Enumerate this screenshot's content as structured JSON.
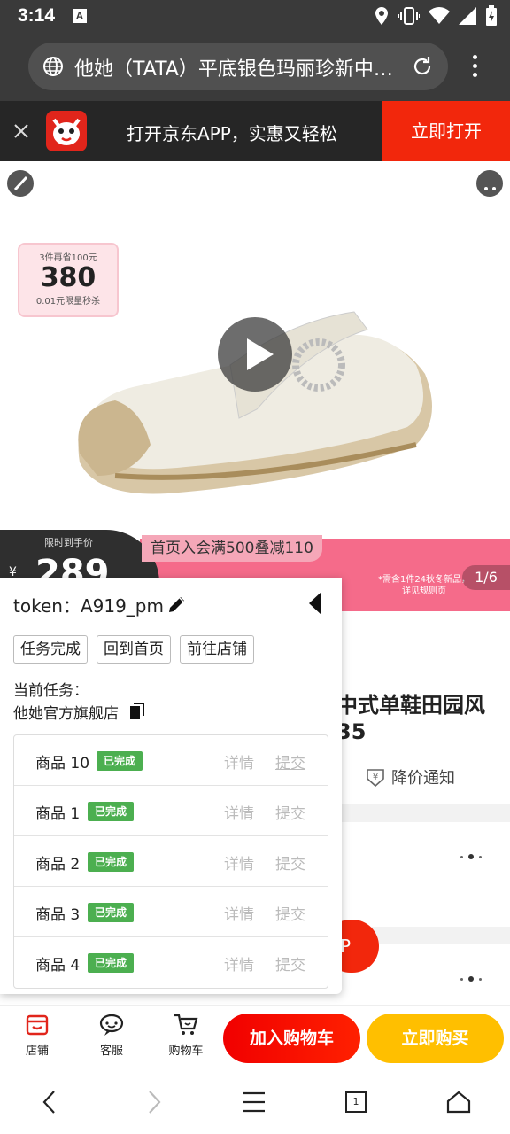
{
  "status_bar": {
    "time": "3:14",
    "notif_glyph": "A"
  },
  "browser": {
    "url_title": "他她（TATA）平底银色玛丽珍新中式单鞋田园风",
    "icons": [
      "globe-icon",
      "reload-icon",
      "overflow-menu-icon"
    ]
  },
  "app_banner": {
    "text": "打开京东APP，实惠又轻松",
    "open_label": "立即打开"
  },
  "gallery": {
    "coupon_top": "3件再省100元",
    "coupon_price": "380",
    "coupon_bottom": "0.01元限量秒杀",
    "counter": "1/6"
  },
  "price_strip": {
    "label": "限时到手价",
    "yen": "¥",
    "price": "289",
    "promo": "首页入会满500叠减110",
    "fine_print": "*需含1件24秋冬新品，详见规则页",
    "colors": {
      "dark": "#2f2f2f",
      "pink": "#f56b8a"
    }
  },
  "product": {
    "title_line1": "中式单鞋田园风",
    "title_line2": "35",
    "price_alert": "降价通知",
    "badge_p": "P"
  },
  "panel": {
    "token_label": "token：",
    "token_value": "A919_pm",
    "buttons": [
      "任务完成",
      "回到首页",
      "前往店铺"
    ],
    "task_label": "当前任务：",
    "task_name": "他她官方旗舰店",
    "rows": [
      {
        "name": "商品 10",
        "status": "已完成",
        "detail": "详情",
        "submit": "提交"
      },
      {
        "name": "商品 1",
        "status": "已完成",
        "detail": "详情",
        "submit": "提交"
      },
      {
        "name": "商品 2",
        "status": "已完成",
        "detail": "详情",
        "submit": "提交"
      },
      {
        "name": "商品 3",
        "status": "已完成",
        "detail": "详情",
        "submit": "提交"
      },
      {
        "name": "商品 4",
        "status": "已完成",
        "detail": "详情",
        "submit": "提交"
      }
    ],
    "status_color": "#4caf50"
  },
  "bottom_bar": {
    "store": "店铺",
    "service": "客服",
    "cart": "购物车",
    "add_to_cart": "加入购物车",
    "buy_now": "立即购买",
    "colors": {
      "cart": "#f10000",
      "buy": "#ffbf00"
    }
  },
  "nav": {
    "tab_count": "1"
  }
}
